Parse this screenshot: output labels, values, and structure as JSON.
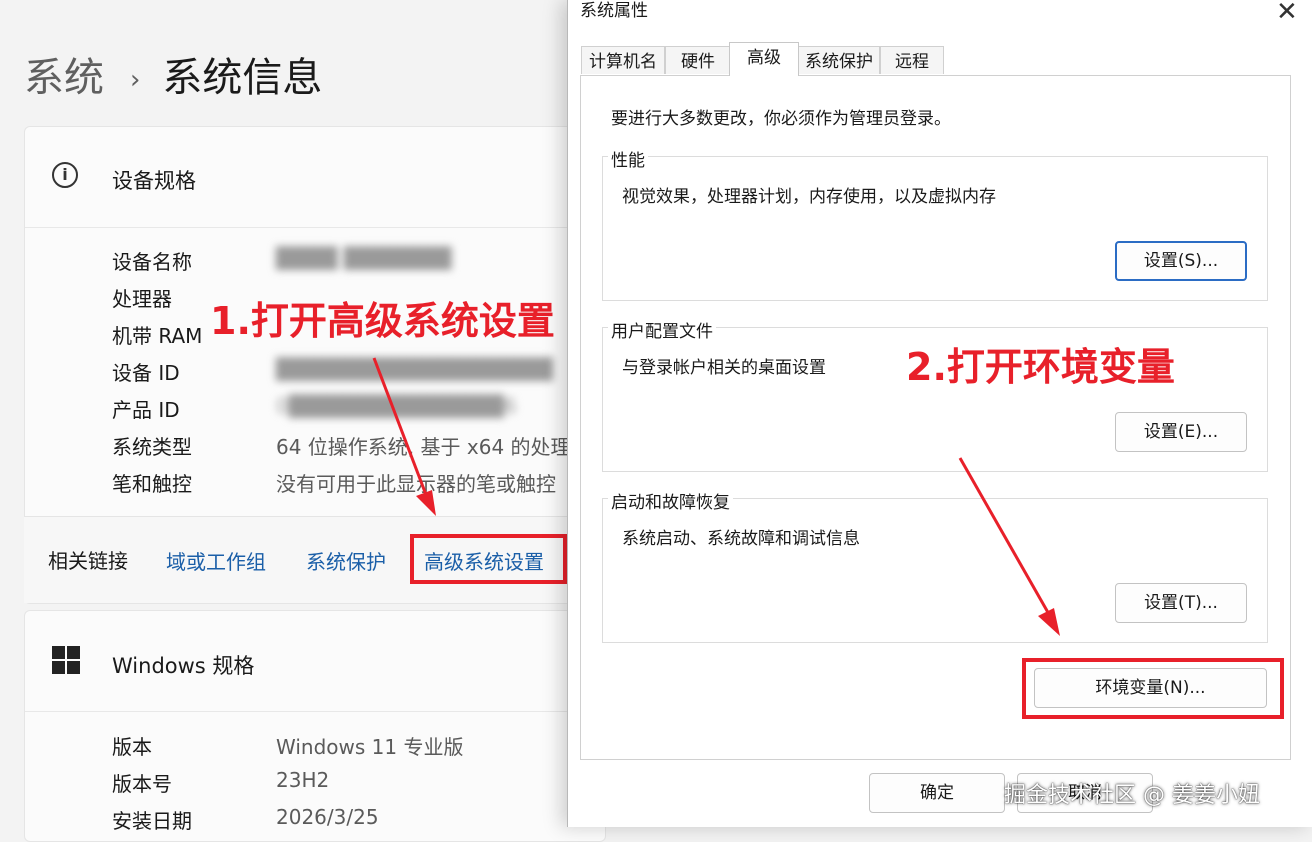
{
  "settings": {
    "breadcrumb": {
      "parent": "系统",
      "separator": "›",
      "current": "系统信息"
    },
    "device_spec": {
      "title": "设备规格",
      "rows": [
        {
          "label": "设备名称",
          "value": "████ ███████"
        },
        {
          "label": "处理器",
          "value": ""
        },
        {
          "label": "机带 RAM",
          "value": ""
        },
        {
          "label": "设备 ID",
          "value": "██████████████████"
        },
        {
          "label": "产品 ID",
          "value": "0██████████████6"
        },
        {
          "label": "系统类型",
          "value": "64 位操作系统, 基于 x64 的处理"
        },
        {
          "label": "笔和触控",
          "value": "没有可用于此显示器的笔或触控"
        }
      ]
    },
    "related_links": {
      "label": "相关链接",
      "links": [
        "域或工作组",
        "系统保护",
        "高级系统设置"
      ]
    },
    "windows_spec": {
      "title": "Windows 规格",
      "rows": [
        {
          "label": "版本",
          "value": "Windows 11 专业版"
        },
        {
          "label": "版本号",
          "value": "23H2"
        },
        {
          "label": "安装日期",
          "value": "2026/3/25"
        }
      ]
    }
  },
  "dialog": {
    "title": "系统属性",
    "tabs": [
      "计算机名",
      "硬件",
      "高级",
      "系统保护",
      "远程"
    ],
    "active_tab": "高级",
    "admin_notice": "要进行大多数更改，你必须作为管理员登录。",
    "groups": [
      {
        "title": "性能",
        "text": "视觉效果，处理器计划，内存使用，以及虚拟内存",
        "button": "设置(S)..."
      },
      {
        "title": "用户配置文件",
        "text": "与登录帐户相关的桌面设置",
        "button": "设置(E)..."
      },
      {
        "title": "启动和故障恢复",
        "text": "系统启动、系统故障和调试信息",
        "button": "设置(T)..."
      }
    ],
    "env_button": "环境变量(N)...",
    "ok_button": "确定",
    "cancel_button": "取消"
  },
  "annotations": {
    "step1": "1.打开高级系统设置",
    "step2": "2.打开环境变量",
    "color": "#e8202a"
  },
  "watermark": "掘金技术社区 @ 姜姜小妞"
}
